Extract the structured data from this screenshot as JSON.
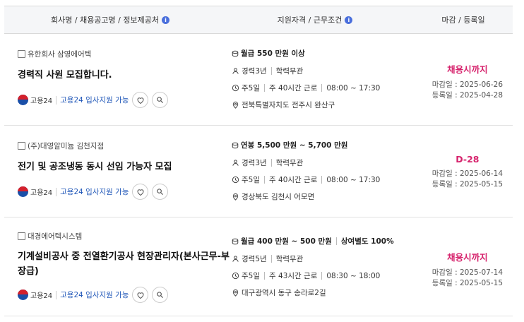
{
  "header": {
    "col1": "회사명 / 채용공고명 / 정보제공처",
    "col2": "지원자격 / 근무조건",
    "col3": "마감 / 등록일",
    "info_icon": "i"
  },
  "jobs": [
    {
      "company": "유한회사 삼영에어텍",
      "title": "경력직 사원 모집합니다.",
      "brand": "고용24",
      "apply": "고용24 입사지원 가능",
      "pay": "월급 550 만원 이상",
      "pay_extra": "",
      "experience": "경력3년",
      "education": "학력무관",
      "days": "주5일",
      "hours": "주 40시간 근로",
      "time": "08:00 ~ 17:30",
      "location": "전북특별자치도 전주시 완산구",
      "status": "채용시까지",
      "deadline": "마감일 : 2025-06-26",
      "registered": "등록일 : 2025-04-28"
    },
    {
      "company": "(주)대영알미늄 김천지점",
      "title": "전기 및 공조냉동 동시 선임 가능자 모집",
      "brand": "고용24",
      "apply": "고용24 입사지원 가능",
      "pay": "연봉 5,500 만원 ~ 5,700 만원",
      "pay_extra": "",
      "experience": "경력3년",
      "education": "학력무관",
      "days": "주5일",
      "hours": "주 40시간 근로",
      "time": "08:00 ~ 17:30",
      "location": "경상북도 김천시 어모면",
      "status": "D-28",
      "deadline": "마감일 : 2025-06-14",
      "registered": "등록일 : 2025-05-15"
    },
    {
      "company": "대경에어텍시스템",
      "title": "기계설비공사 중 전열환기공사 현장관리자(본사근무-부장급)",
      "brand": "고용24",
      "apply": "고용24 입사지원 가능",
      "pay": "월급 400 만원 ~ 500 만원",
      "pay_extra": "상여별도 100%",
      "experience": "경력5년",
      "education": "학력무관",
      "days": "주5일",
      "hours": "주 43시간 근로",
      "time": "08:30 ~ 18:00",
      "location": "대구광역시 동구 송라로2길",
      "status": "채용시까지",
      "deadline": "마감일 : 2025-07-14",
      "registered": "등록일 : 2025-05-15"
    }
  ],
  "colors": {
    "accent": "#d6226c",
    "link": "#1f56b8",
    "info": "#4a6fdc"
  },
  "icons": [
    "info-icon",
    "checkbox-icon",
    "korea-flag-icon",
    "heart-icon",
    "search-icon",
    "coin-icon",
    "person-icon",
    "clock-icon",
    "location-pin-icon"
  ]
}
